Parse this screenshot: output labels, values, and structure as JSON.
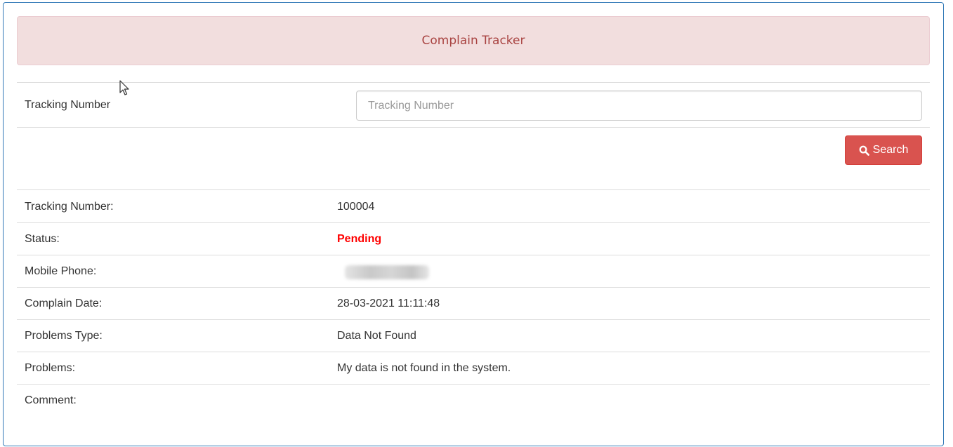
{
  "header": {
    "title": "Complain Tracker"
  },
  "search": {
    "label": "Tracking Number",
    "placeholder": "Tracking Number",
    "value": "",
    "button_label": "Search",
    "button_icon": "search-icon"
  },
  "details": {
    "tracking_number": {
      "label": "Tracking Number:",
      "value": "100004"
    },
    "status": {
      "label": "Status:",
      "value": "Pending"
    },
    "mobile_phone": {
      "label": "Mobile Phone:"
    },
    "complain_date": {
      "label": "Complain Date:",
      "value": "28-03-2021 11:11:48"
    },
    "problems_type": {
      "label": "Problems Type:",
      "value": "Data Not Found"
    },
    "problems": {
      "label": "Problems:",
      "value": "My data is not found in the system."
    },
    "comment": {
      "label": "Comment:",
      "value": ""
    }
  },
  "colors": {
    "header_bg": "#f2dede",
    "header_text": "#a94442",
    "button_bg": "#d9534f",
    "status_pending": "#ff0000",
    "panel_border": "#337ab7"
  }
}
